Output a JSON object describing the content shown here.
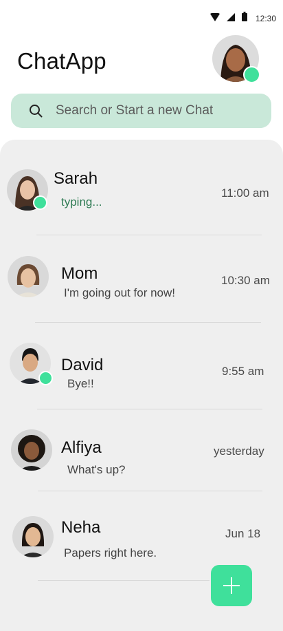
{
  "status_bar": {
    "time": "12:30",
    "icons": [
      "wifi-icon",
      "signal-icon",
      "battery-icon"
    ]
  },
  "header": {
    "title": "ChatApp",
    "profile_online": true
  },
  "search": {
    "placeholder": "Search or Start a new Chat",
    "icon": "search-icon"
  },
  "chats": [
    {
      "name": "Sarah",
      "message": "typing...",
      "time": "11:00 am",
      "online": true,
      "typing": true
    },
    {
      "name": "Mom",
      "message": "I'm going out for now!",
      "time": "10:30 am",
      "online": false,
      "typing": false
    },
    {
      "name": "David",
      "message": "Bye!!",
      "time": "9:55 am",
      "online": true,
      "typing": false
    },
    {
      "name": "Alfiya",
      "message": "What's up?",
      "time": "yesterday",
      "online": false,
      "typing": false
    },
    {
      "name": "Neha",
      "message": "Papers right here.",
      "time": "Jun 18",
      "online": false,
      "typing": false
    }
  ],
  "fab": {
    "icon": "plus-icon"
  },
  "colors": {
    "accent": "#3fe09b",
    "search_bg": "#c9e8d9",
    "panel_bg": "#efefef",
    "typing": "#2d7a52"
  }
}
